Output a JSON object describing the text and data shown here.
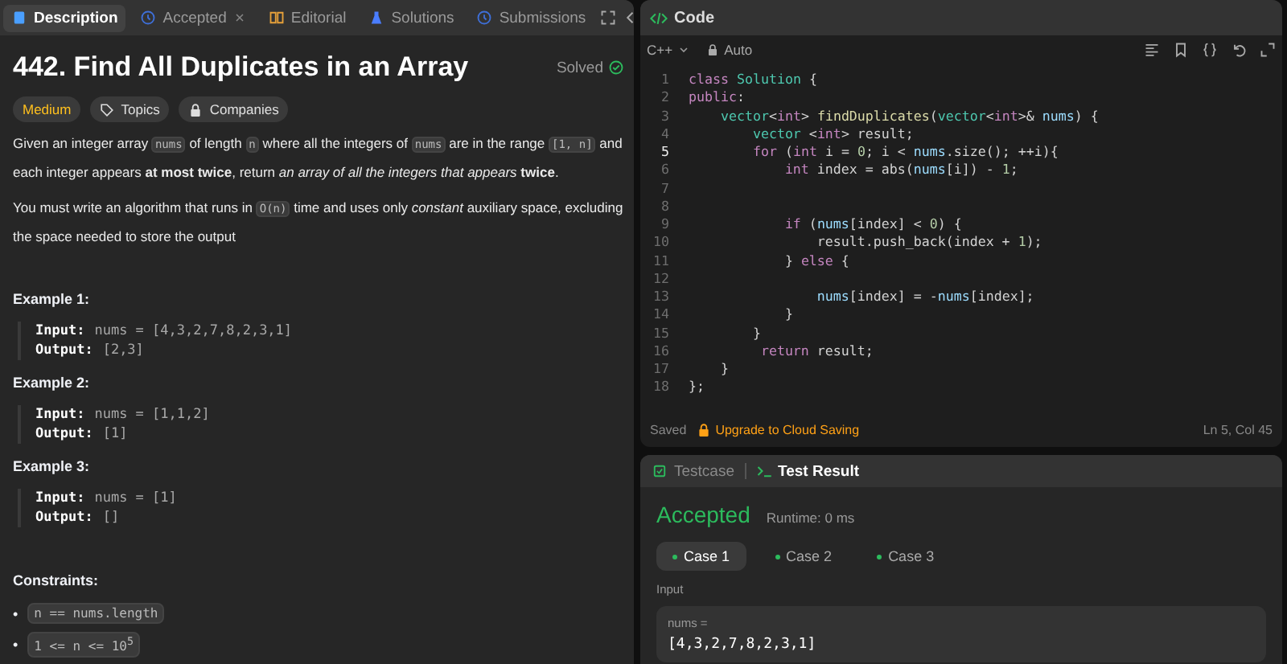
{
  "description_panel": {
    "tabs": [
      {
        "label": "Description",
        "selected": true,
        "closable": false
      },
      {
        "label": "Accepted",
        "selected": false,
        "closable": true
      },
      {
        "label": "Editorial",
        "selected": false,
        "closable": false
      },
      {
        "label": "Solutions",
        "selected": false,
        "closable": false
      },
      {
        "label": "Submissions",
        "selected": false,
        "closable": false
      }
    ],
    "title": "442. Find All Duplicates in an Array",
    "status": "Solved",
    "tags": [
      {
        "label": "Medium",
        "kind": "difficulty"
      },
      {
        "label": "Topics",
        "kind": "topics"
      },
      {
        "label": "Companies",
        "kind": "companies"
      }
    ],
    "paragraphs": [
      [
        {
          "kind": "text",
          "text": "Given an integer array "
        },
        {
          "kind": "code",
          "text": "nums"
        },
        {
          "kind": "text",
          "text": " of length "
        },
        {
          "kind": "code",
          "text": "n"
        },
        {
          "kind": "text",
          "text": " where all the integers of "
        },
        {
          "kind": "code",
          "text": "nums"
        },
        {
          "kind": "text",
          "text": " are in the range "
        },
        {
          "kind": "code",
          "text": "[1, n]"
        },
        {
          "kind": "text",
          "text": " and each integer appears **at most twice**, return *an array of all the integers that appears* **twice**."
        }
      ],
      [
        {
          "kind": "text",
          "text": "You must write an algorithm that runs in "
        },
        {
          "kind": "code",
          "text": "O(n)"
        },
        {
          "kind": "text",
          "text": " time and uses only *constant* auxiliary space, excluding the space needed to store the output"
        }
      ]
    ],
    "examples": [
      {
        "heading": "Example 1:",
        "input_label": "Input:",
        "input": "nums = [4,3,2,7,8,2,3,1]",
        "output_label": "Output:",
        "output": "[2,3]"
      },
      {
        "heading": "Example 2:",
        "input_label": "Input:",
        "input": "nums = [1,1,2]",
        "output_label": "Output:",
        "output": "[1]"
      },
      {
        "heading": "Example 3:",
        "input_label": "Input:",
        "input": "nums = [1]",
        "output_label": "Output:",
        "output": "[]"
      }
    ],
    "constraints_heading": "Constraints:",
    "constraints": [
      {
        "bullet": "•",
        "text": "n == nums.length"
      },
      {
        "bullet": "•",
        "text": "1 <= n <= 10$^{5}$"
      }
    ]
  },
  "code_panel": {
    "title": "Code",
    "language": "C++",
    "mode": "Auto",
    "lines": [
      {
        "number": "1",
        "current": false,
        "tokens": [
          {
            "kind": "kw",
            "text": "class "
          },
          {
            "kind": "type",
            "text": "Solution"
          },
          {
            "kind": "plain",
            "text": " {"
          }
        ]
      },
      {
        "number": "2",
        "current": false,
        "tokens": [
          {
            "kind": "kw",
            "text": "public"
          },
          {
            "kind": "plain",
            "text": ":"
          }
        ]
      },
      {
        "number": "3",
        "current": false,
        "tokens": [
          {
            "kind": "type",
            "text": "    vector"
          },
          {
            "kind": "plain",
            "text": "<"
          },
          {
            "kind": "kw",
            "text": "int"
          },
          {
            "kind": "plain",
            "text": "> "
          },
          {
            "kind": "fn",
            "text": "findDuplicates"
          },
          {
            "kind": "plain",
            "text": "("
          },
          {
            "kind": "type",
            "text": "vector"
          },
          {
            "kind": "plain",
            "text": "<"
          },
          {
            "kind": "kw",
            "text": "int"
          },
          {
            "kind": "plain",
            "text": ">& "
          },
          {
            "kind": "var",
            "text": "nums"
          },
          {
            "kind": "plain",
            "text": ") {"
          }
        ]
      },
      {
        "number": "4",
        "current": false,
        "tokens": [
          {
            "kind": "type",
            "text": "        vector"
          },
          {
            "kind": "plain",
            "text": " <"
          },
          {
            "kind": "kw",
            "text": "int"
          },
          {
            "kind": "plain",
            "text": "> result;"
          }
        ]
      },
      {
        "number": "5",
        "current": true,
        "tokens": [
          {
            "kind": "kw",
            "text": "        for"
          },
          {
            "kind": "plain",
            "text": " ("
          },
          {
            "kind": "kw",
            "text": "int"
          },
          {
            "kind": "plain",
            "text": " i = "
          },
          {
            "kind": "num",
            "text": "0"
          },
          {
            "kind": "plain",
            "text": "; i < "
          },
          {
            "kind": "var",
            "text": "nums"
          },
          {
            "kind": "plain",
            "text": ".size(); ++i){"
          }
        ]
      },
      {
        "number": "6",
        "current": false,
        "tokens": [
          {
            "kind": "kw",
            "text": "            int"
          },
          {
            "kind": "plain",
            "text": " index = abs("
          },
          {
            "kind": "var",
            "text": "nums"
          },
          {
            "kind": "plain",
            "text": "[i]) - "
          },
          {
            "kind": "num",
            "text": "1"
          },
          {
            "kind": "plain",
            "text": ";"
          }
        ]
      },
      {
        "number": "7",
        "current": false
      },
      {
        "number": "8",
        "current": false
      },
      {
        "number": "9",
        "current": false,
        "tokens": [
          {
            "kind": "kw",
            "text": "            if"
          },
          {
            "kind": "plain",
            "text": " ("
          },
          {
            "kind": "var",
            "text": "nums"
          },
          {
            "kind": "plain",
            "text": "[index] < "
          },
          {
            "kind": "num",
            "text": "0"
          },
          {
            "kind": "plain",
            "text": ") {"
          }
        ]
      },
      {
        "number": "10",
        "current": false,
        "tokens": [
          {
            "kind": "plain",
            "text": "                result.push_back(index + "
          },
          {
            "kind": "num",
            "text": "1"
          },
          {
            "kind": "plain",
            "text": ");"
          }
        ]
      },
      {
        "number": "11",
        "current": false,
        "tokens": [
          {
            "kind": "plain",
            "text": "            } "
          },
          {
            "kind": "kw",
            "text": "else"
          },
          {
            "kind": "plain",
            "text": " {"
          }
        ]
      },
      {
        "number": "12",
        "current": false
      },
      {
        "number": "13",
        "current": false,
        "tokens": [
          {
            "kind": "var",
            "text": "                nums"
          },
          {
            "kind": "plain",
            "text": "[index] = -"
          },
          {
            "kind": "var",
            "text": "nums"
          },
          {
            "kind": "plain",
            "text": "[index];"
          }
        ]
      },
      {
        "number": "14",
        "current": false,
        "tokens": [
          {
            "kind": "plain",
            "text": "            }"
          }
        ]
      },
      {
        "number": "15",
        "current": false,
        "tokens": [
          {
            "kind": "plain",
            "text": "        }"
          }
        ]
      },
      {
        "number": "16",
        "current": false,
        "tokens": [
          {
            "kind": "kw",
            "text": "         return"
          },
          {
            "kind": "plain",
            "text": " result;"
          }
        ]
      },
      {
        "number": "17",
        "current": false,
        "tokens": [
          {
            "kind": "plain",
            "text": "    }"
          }
        ]
      },
      {
        "number": "18",
        "current": false,
        "tokens": [
          {
            "kind": "plain",
            "text": "};"
          }
        ]
      }
    ],
    "save_status": "Saved",
    "upgrade_link": "Upgrade to Cloud Saving",
    "cursor": "Ln 5, Col 45"
  },
  "result_panel": {
    "tabs": [
      {
        "label": "Testcase",
        "selected": false
      },
      {
        "label": "Test Result",
        "selected": true
      }
    ],
    "verdict": "Accepted",
    "runtime": "Runtime: 0 ms",
    "cases": [
      {
        "label": "Case 1",
        "selected": true
      },
      {
        "label": "Case 2",
        "selected": false
      },
      {
        "label": "Case 3",
        "selected": false
      }
    ],
    "input_label": "Input",
    "variable": "nums =",
    "value": "[4,3,2,7,8,2,3,1]"
  }
}
